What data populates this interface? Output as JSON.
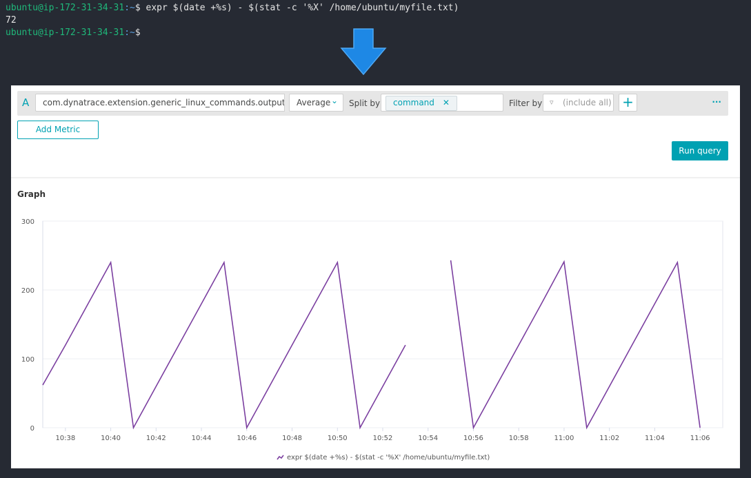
{
  "terminal": {
    "lines": [
      {
        "prompt_user": "ubuntu@ip-172-31-34-31",
        "prompt_path": ":~",
        "prompt_sym": "$",
        "command": " expr $(date +%s) - $(stat -c '%X' /home/ubuntu/myfile.txt)"
      },
      {
        "output": "72"
      },
      {
        "prompt_user": "ubuntu@ip-172-31-34-31",
        "prompt_path": ":~",
        "prompt_sym": "$",
        "command": ""
      }
    ]
  },
  "arrow": {
    "icon": "arrow-down-icon",
    "color": "#1e88e5"
  },
  "query": {
    "letter": "A",
    "metric": "com.dynatrace.extension.generic_linux_commands.output",
    "aggregation": "Average",
    "split_by_label": "Split by",
    "split_by_chip": "command",
    "filter_by_label": "Filter by",
    "filter_placeholder": "(include all)",
    "add_metric": "Add Metric",
    "run_query": "Run query",
    "more": "···",
    "plus": "+"
  },
  "graph_title": "Graph",
  "colors": {
    "accent": "#00a1b2",
    "series": "#7b3fa0"
  },
  "chart_data": {
    "type": "line",
    "title": "",
    "xlabel": "",
    "ylabel": "",
    "xlim": [
      "10:37",
      "11:07"
    ],
    "ylim": [
      0,
      300
    ],
    "yticks": [
      0,
      100,
      200,
      300
    ],
    "xticks": [
      "10:38",
      "10:40",
      "10:42",
      "10:44",
      "10:46",
      "10:48",
      "10:50",
      "10:52",
      "10:54",
      "10:56",
      "10:58",
      "11:00",
      "11:02",
      "11:04",
      "11:06"
    ],
    "grid": true,
    "legend_placement": "bottom",
    "x": [
      "10:37",
      "10:38",
      "10:39",
      "10:40",
      "10:41",
      "10:42",
      "10:43",
      "10:44",
      "10:45",
      "10:46",
      "10:47",
      "10:48",
      "10:49",
      "10:50",
      "10:51",
      "10:52",
      "10:53",
      "10:54",
      "10:55",
      "10:56",
      "10:57",
      "10:58",
      "10:59",
      "11:00",
      "11:01",
      "11:02",
      "11:03",
      "11:04",
      "11:05",
      "11:06"
    ],
    "series": [
      {
        "name": "expr $(date +%s) - $(stat -c '%X' /home/ubuntu/myfile.txt)",
        "values": [
          62,
          120,
          180,
          240,
          0,
          60,
          120,
          180,
          240,
          0,
          60,
          120,
          180,
          240,
          0,
          60,
          120,
          null,
          243,
          0,
          60,
          120,
          180,
          241,
          0,
          60,
          120,
          180,
          240,
          0
        ]
      }
    ]
  }
}
